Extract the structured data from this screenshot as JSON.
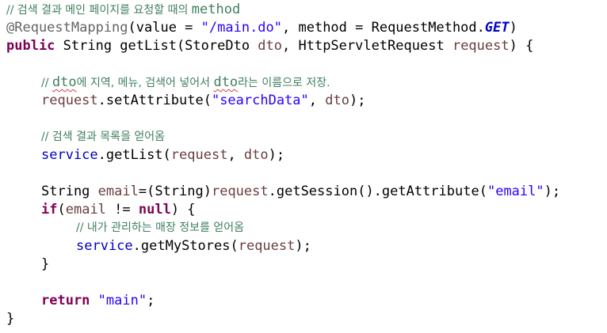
{
  "code": {
    "l1": {
      "c1": "// 검색 결과 메인 페이지를 요청할 때의 ",
      "c2": "method"
    },
    "l2": {
      "t1": "@RequestMapping",
      "t2": "(value = ",
      "t3": "\"/main.do\"",
      "t4": ", method = RequestMethod.",
      "t5": "GET",
      "t6": ")"
    },
    "l3": {
      "t1": "public",
      "t2": " String getList(StoreDto ",
      "t3": "dto",
      "t4": ", HttpServletRequest ",
      "t5": "request",
      "t6": ") {"
    },
    "l4": {
      "c1": "// ",
      "c2": "dto",
      "c3": "에 지역, 메뉴, 검색어 넣어서 ",
      "c4": "dto",
      "c5": "라는 이름으로 저장."
    },
    "l5": {
      "t1": "request",
      "t2": ".setAttribute(",
      "t3": "\"searchData\"",
      "t4": ", ",
      "t5": "dto",
      "t6": ");"
    },
    "l6": {
      "c1": "// 검색 결과 목록을 얻어옴"
    },
    "l7": {
      "t1": "service",
      "t2": ".getList(",
      "t3": "request",
      "t4": ", ",
      "t5": "dto",
      "t6": ");"
    },
    "l8": {
      "t1": "String ",
      "t2": "email",
      "t3": "=(String)",
      "t4": "request",
      "t5": ".getSession().getAttribute(",
      "t6": "\"email\"",
      "t7": ");"
    },
    "l9": {
      "t1": "if",
      "t2": "(",
      "t3": "email",
      "t4": " != ",
      "t5": "null",
      "t6": ") {"
    },
    "l10": {
      "c1": "// 내가 관리하는 매장 정보를 얻어옴"
    },
    "l11": {
      "t1": "service",
      "t2": ".getMyStores(",
      "t3": "request",
      "t4": ");"
    },
    "l12": {
      "t1": "}"
    },
    "l13": {
      "t1": "return",
      "t2": " ",
      "t3": "\"main\"",
      "t4": ";"
    },
    "l14": {
      "t1": "}"
    }
  },
  "colors": {
    "keyword": "#7f0055",
    "annotation": "#646464",
    "string": "#2a00ff",
    "comment": "#3f7f5f",
    "field": "#0000c0",
    "variable": "#6a3e3e"
  }
}
